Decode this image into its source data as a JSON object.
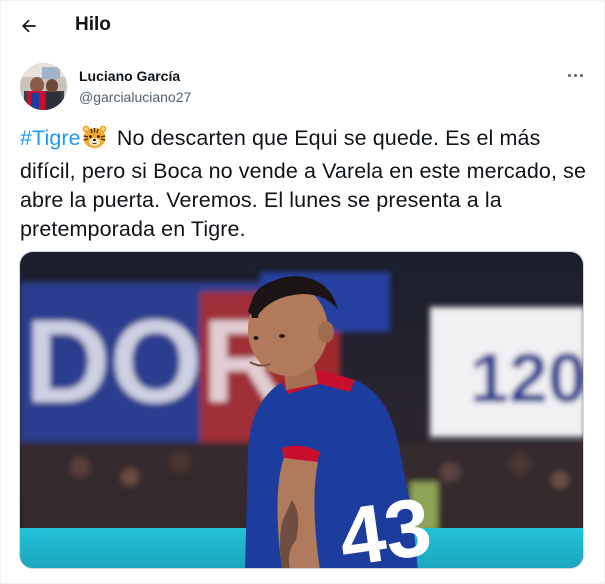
{
  "header": {
    "title": "Hilo",
    "back_icon": "arrow-left-icon"
  },
  "tweet": {
    "author_name": "Luciano García",
    "author_handle": "@garcialuciano27",
    "more_icon": "more-horizontal-icon",
    "hashtag": "#Tigre",
    "emoji": "tiger-face-icon",
    "body": "No descarten que Equi se quede. Es el más difícil, pero si Boca no vende a Varela en este mercado, se abre la puerta. Veremos. El lunes se presenta a la pretemporada en Tigre.",
    "media": {
      "jersey_number": "43",
      "banner_text_left": "DOR",
      "banner_text_right": "120"
    }
  },
  "colors": {
    "text": "#0f1419",
    "secondary": "#536471",
    "accent": "#1d9bf0",
    "jersey_blue": "#1d3d9e",
    "jersey_red": "#c8102e"
  }
}
